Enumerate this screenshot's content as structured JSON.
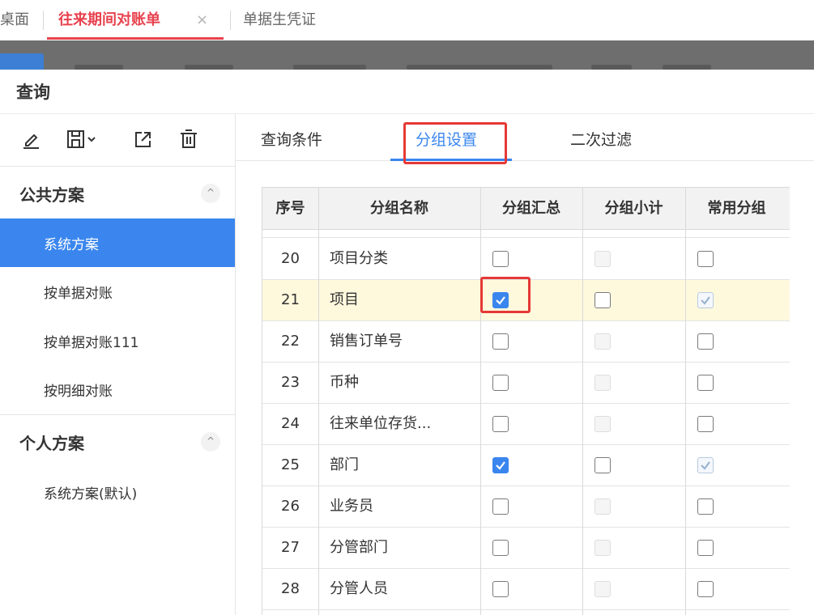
{
  "tabs": {
    "desktop": "桌面",
    "active": "往来期间对账单",
    "close": "×",
    "voucher": "单据生凭证"
  },
  "dialog": {
    "title": "查询"
  },
  "left_toolbar": {
    "icons": [
      "edit-icon",
      "save-dropdown-icon",
      "export-icon",
      "delete-icon"
    ]
  },
  "public_schemes": {
    "title": "公共方案",
    "collapse": "^",
    "items": [
      "系统方案",
      "按单据对账",
      "按单据对账111",
      "按明细对账"
    ],
    "selected": "系统方案"
  },
  "personal_schemes": {
    "title": "个人方案",
    "collapse": "^",
    "items": [
      "系统方案(默认)"
    ]
  },
  "sub_tabs": [
    "查询条件",
    "分组设置",
    "二次过滤"
  ],
  "active_sub_tab": "分组设置",
  "table": {
    "headers": [
      "序号",
      "分组名称",
      "分组汇总",
      "分组小计",
      "常用分组"
    ],
    "rows": [
      {
        "no": "20",
        "name": "项目分类",
        "summary": "unchecked",
        "subtotal": "disabled",
        "common": "unchecked"
      },
      {
        "no": "21",
        "name": "项目",
        "summary": "checked",
        "subtotal": "unchecked",
        "common": "checked-disabled",
        "highlighted": true
      },
      {
        "no": "22",
        "name": "销售订单号",
        "summary": "unchecked",
        "subtotal": "disabled",
        "common": "unchecked"
      },
      {
        "no": "23",
        "name": "币种",
        "summary": "unchecked",
        "subtotal": "disabled",
        "common": "unchecked"
      },
      {
        "no": "24",
        "name": "往来单位存货...",
        "summary": "unchecked",
        "subtotal": "disabled",
        "common": "unchecked"
      },
      {
        "no": "25",
        "name": "部门",
        "summary": "checked",
        "subtotal": "unchecked",
        "common": "checked-disabled"
      },
      {
        "no": "26",
        "name": "业务员",
        "summary": "unchecked",
        "subtotal": "disabled",
        "common": "unchecked"
      },
      {
        "no": "27",
        "name": "分管部门",
        "summary": "unchecked",
        "subtotal": "disabled",
        "common": "unchecked"
      },
      {
        "no": "28",
        "name": "分管人员",
        "summary": "unchecked",
        "subtotal": "disabled",
        "common": "unchecked"
      }
    ]
  },
  "colors": {
    "accent_blue": "#3a86ee",
    "tab_red": "#e8424e",
    "annotation_red": "#e53935",
    "row_highlight": "#fef8dd"
  }
}
